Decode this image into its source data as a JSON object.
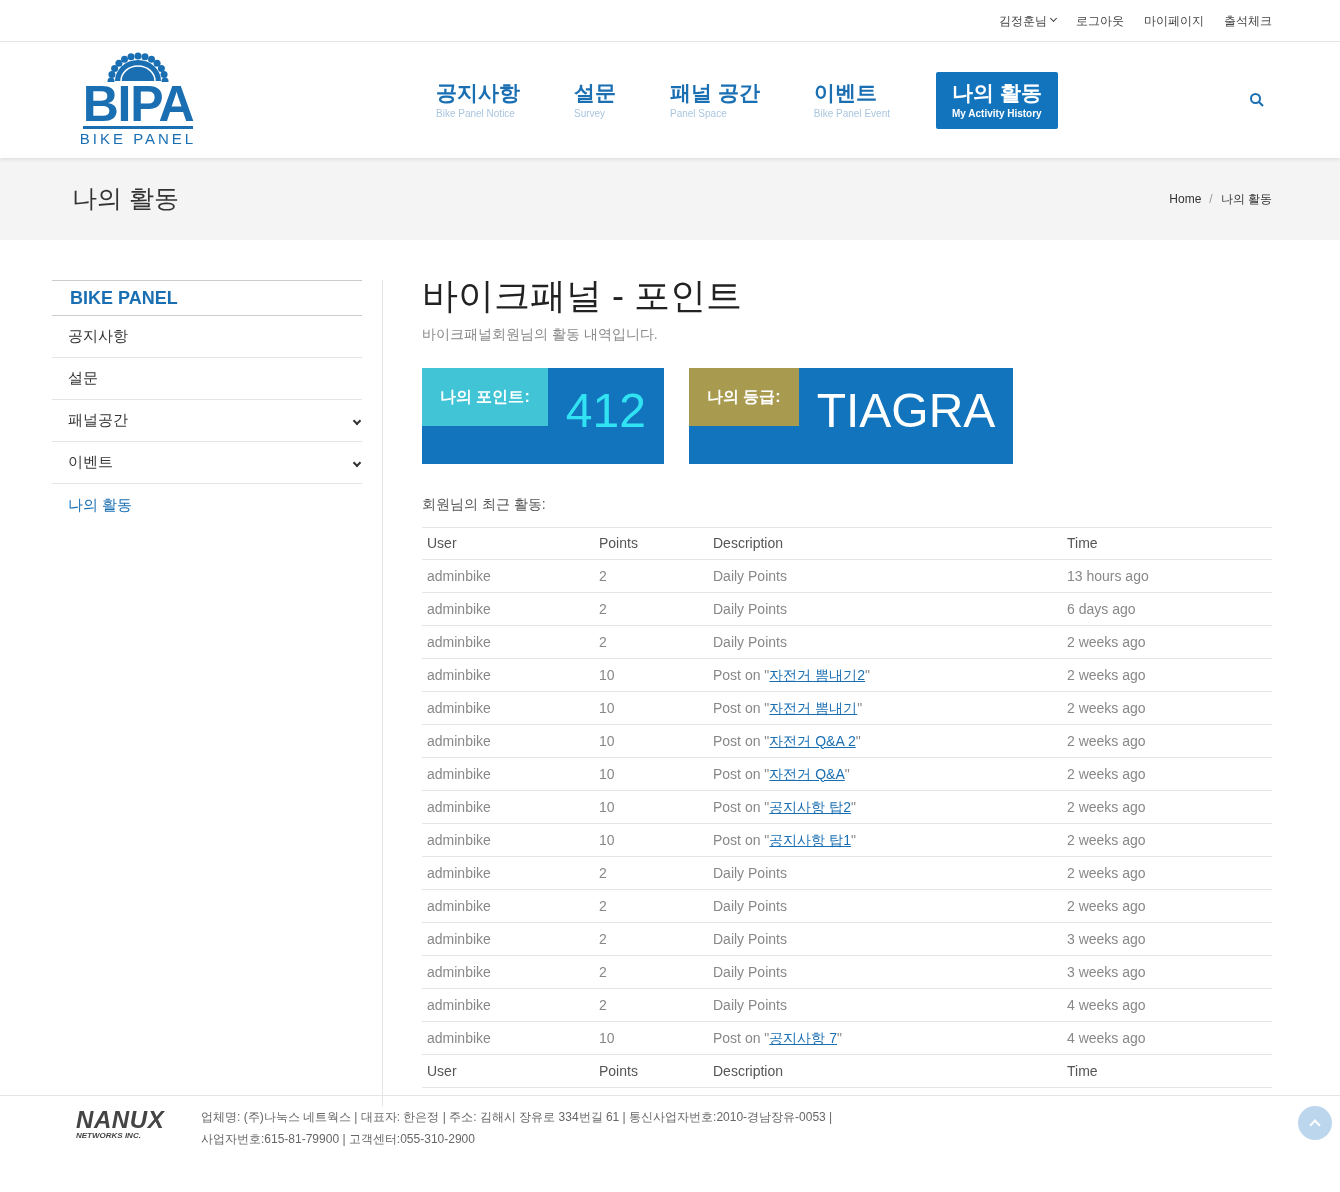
{
  "top_bar": {
    "user": "김정훈님",
    "links": [
      "로그아웃",
      "마이페이지",
      "출석체크"
    ]
  },
  "logo": {
    "name": "BIPA",
    "tagline": "BIKE PANEL"
  },
  "nav": [
    {
      "title": "공지사항",
      "subtitle": "Bike Panel Notice",
      "selected": false
    },
    {
      "title": "설문",
      "subtitle": "Survey",
      "selected": false
    },
    {
      "title": "패널 공간",
      "subtitle": "Panel Space",
      "selected": false
    },
    {
      "title": "이벤트",
      "subtitle": "Bike Panel Event",
      "selected": false
    },
    {
      "title": "나의 활동",
      "subtitle": "My Activity History",
      "selected": true
    }
  ],
  "page_title": "나의 활동",
  "breadcrumb": [
    "Home",
    "나의 활동"
  ],
  "breadcrumb_separator": "/",
  "sidebar": {
    "heading": "BIKE PANEL",
    "items": [
      {
        "label": "공지사항",
        "expandable": false,
        "selected": false
      },
      {
        "label": "설문",
        "expandable": false,
        "selected": false
      },
      {
        "label": "패널공간",
        "expandable": true,
        "selected": false
      },
      {
        "label": "이벤트",
        "expandable": true,
        "selected": false
      },
      {
        "label": "나의 활동",
        "expandable": false,
        "selected": true
      }
    ]
  },
  "content": {
    "title": "바이크패널 - 포인트",
    "subtitle": "바이크패널회원님의 활동 내역입니다.",
    "cards": [
      {
        "label": "나의 포인트:",
        "value": "412",
        "color": "#40c4d6"
      },
      {
        "label": "나의 등급:",
        "value": "TIAGRA",
        "color": "#a89a4e"
      }
    ],
    "table_caption": "회원님의 최근 활동:",
    "columns": [
      "User",
      "Points",
      "Description",
      "Time"
    ],
    "rows": [
      {
        "user": "adminbike",
        "points": "2",
        "description": {
          "kind": "plain",
          "text": "Daily Points"
        },
        "time": "13 hours ago"
      },
      {
        "user": "adminbike",
        "points": "2",
        "description": {
          "kind": "plain",
          "text": "Daily Points"
        },
        "time": "6 days ago"
      },
      {
        "user": "adminbike",
        "points": "2",
        "description": {
          "kind": "plain",
          "text": "Daily Points"
        },
        "time": "2 weeks ago"
      },
      {
        "user": "adminbike",
        "points": "10",
        "description": {
          "kind": "post",
          "text": "Post on \"",
          "link": "자전거 뽐내기2",
          "suffix": "\""
        },
        "time": "2 weeks ago"
      },
      {
        "user": "adminbike",
        "points": "10",
        "description": {
          "kind": "post",
          "text": "Post on \"",
          "link": "자전거 뽐내기",
          "suffix": "\""
        },
        "time": "2 weeks ago"
      },
      {
        "user": "adminbike",
        "points": "10",
        "description": {
          "kind": "post",
          "text": "Post on \"",
          "link": "자전거 Q&A 2",
          "suffix": "\""
        },
        "time": "2 weeks ago"
      },
      {
        "user": "adminbike",
        "points": "10",
        "description": {
          "kind": "post",
          "text": "Post on \"",
          "link": "자전거 Q&A",
          "suffix": "\""
        },
        "time": "2 weeks ago"
      },
      {
        "user": "adminbike",
        "points": "10",
        "description": {
          "kind": "post",
          "text": "Post on \"",
          "link": "공지사항 탑2",
          "suffix": "\""
        },
        "time": "2 weeks ago"
      },
      {
        "user": "adminbike",
        "points": "10",
        "description": {
          "kind": "post",
          "text": "Post on \"",
          "link": "공지사항 탑1",
          "suffix": "\""
        },
        "time": "2 weeks ago"
      },
      {
        "user": "adminbike",
        "points": "2",
        "description": {
          "kind": "plain",
          "text": "Daily Points"
        },
        "time": "2 weeks ago"
      },
      {
        "user": "adminbike",
        "points": "2",
        "description": {
          "kind": "plain",
          "text": "Daily Points"
        },
        "time": "2 weeks ago"
      },
      {
        "user": "adminbike",
        "points": "2",
        "description": {
          "kind": "plain",
          "text": "Daily Points"
        },
        "time": "3 weeks ago"
      },
      {
        "user": "adminbike",
        "points": "2",
        "description": {
          "kind": "plain",
          "text": "Daily Points"
        },
        "time": "3 weeks ago"
      },
      {
        "user": "adminbike",
        "points": "2",
        "description": {
          "kind": "plain",
          "text": "Daily Points"
        },
        "time": "4 weeks ago"
      },
      {
        "user": "adminbike",
        "points": "10",
        "description": {
          "kind": "post",
          "text": "Post on \"",
          "link": "공지사항 7",
          "suffix": "\""
        },
        "time": "4 weeks ago"
      }
    ],
    "footer_columns": [
      "User",
      "Points",
      "Description",
      "Time"
    ]
  },
  "footer": {
    "logo": "NANUX",
    "logo_sub": "NETWORKS INC.",
    "lines": [
      "업체명: (주)나눅스 네트웍스 | 대표자: 한은정 | 주소: 김해시 장유로 334번길 61 | 통신사업자번호:2010-경남장유-0053 |",
      "사업자번호:615-81-79900 | 고객센터:055-310-2900"
    ]
  }
}
